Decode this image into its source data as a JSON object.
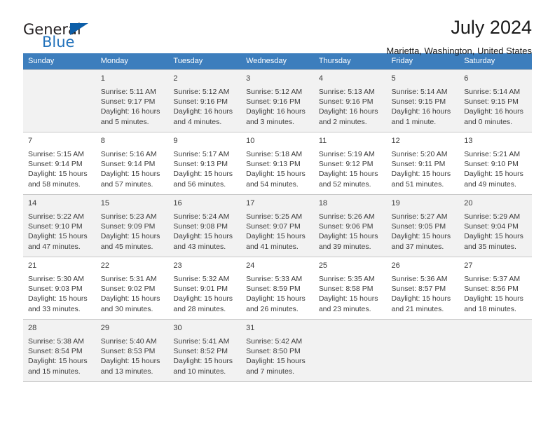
{
  "brand": {
    "name_part1": "General",
    "name_part2": "Blue",
    "triangle_color": "#0c5ea8",
    "blue_color": "#2272bb"
  },
  "header": {
    "title": "July 2024",
    "subtitle": "Marietta, Washington, United States",
    "header_bg_color": "#3d7ebd",
    "shaded_row_color": "#f2f2f2"
  },
  "weekday_headers": [
    "Sunday",
    "Monday",
    "Tuesday",
    "Wednesday",
    "Thursday",
    "Friday",
    "Saturday"
  ],
  "labels": {
    "sunrise": "Sunrise:",
    "sunset": "Sunset:",
    "daylight": "Daylight:"
  },
  "weeks": [
    {
      "shaded": true,
      "days": [
        {
          "num": "",
          "info": ""
        },
        {
          "num": "1",
          "info": "Sunrise: 5:11 AM\nSunset: 9:17 PM\nDaylight: 16 hours\nand 5 minutes."
        },
        {
          "num": "2",
          "info": "Sunrise: 5:12 AM\nSunset: 9:16 PM\nDaylight: 16 hours\nand 4 minutes."
        },
        {
          "num": "3",
          "info": "Sunrise: 5:12 AM\nSunset: 9:16 PM\nDaylight: 16 hours\nand 3 minutes."
        },
        {
          "num": "4",
          "info": "Sunrise: 5:13 AM\nSunset: 9:16 PM\nDaylight: 16 hours\nand 2 minutes."
        },
        {
          "num": "5",
          "info": "Sunrise: 5:14 AM\nSunset: 9:15 PM\nDaylight: 16 hours\nand 1 minute."
        },
        {
          "num": "6",
          "info": "Sunrise: 5:14 AM\nSunset: 9:15 PM\nDaylight: 16 hours\nand 0 minutes."
        }
      ]
    },
    {
      "shaded": false,
      "days": [
        {
          "num": "7",
          "info": "Sunrise: 5:15 AM\nSunset: 9:14 PM\nDaylight: 15 hours\nand 58 minutes."
        },
        {
          "num": "8",
          "info": "Sunrise: 5:16 AM\nSunset: 9:14 PM\nDaylight: 15 hours\nand 57 minutes."
        },
        {
          "num": "9",
          "info": "Sunrise: 5:17 AM\nSunset: 9:13 PM\nDaylight: 15 hours\nand 56 minutes."
        },
        {
          "num": "10",
          "info": "Sunrise: 5:18 AM\nSunset: 9:13 PM\nDaylight: 15 hours\nand 54 minutes."
        },
        {
          "num": "11",
          "info": "Sunrise: 5:19 AM\nSunset: 9:12 PM\nDaylight: 15 hours\nand 52 minutes."
        },
        {
          "num": "12",
          "info": "Sunrise: 5:20 AM\nSunset: 9:11 PM\nDaylight: 15 hours\nand 51 minutes."
        },
        {
          "num": "13",
          "info": "Sunrise: 5:21 AM\nSunset: 9:10 PM\nDaylight: 15 hours\nand 49 minutes."
        }
      ]
    },
    {
      "shaded": true,
      "days": [
        {
          "num": "14",
          "info": "Sunrise: 5:22 AM\nSunset: 9:10 PM\nDaylight: 15 hours\nand 47 minutes."
        },
        {
          "num": "15",
          "info": "Sunrise: 5:23 AM\nSunset: 9:09 PM\nDaylight: 15 hours\nand 45 minutes."
        },
        {
          "num": "16",
          "info": "Sunrise: 5:24 AM\nSunset: 9:08 PM\nDaylight: 15 hours\nand 43 minutes."
        },
        {
          "num": "17",
          "info": "Sunrise: 5:25 AM\nSunset: 9:07 PM\nDaylight: 15 hours\nand 41 minutes."
        },
        {
          "num": "18",
          "info": "Sunrise: 5:26 AM\nSunset: 9:06 PM\nDaylight: 15 hours\nand 39 minutes."
        },
        {
          "num": "19",
          "info": "Sunrise: 5:27 AM\nSunset: 9:05 PM\nDaylight: 15 hours\nand 37 minutes."
        },
        {
          "num": "20",
          "info": "Sunrise: 5:29 AM\nSunset: 9:04 PM\nDaylight: 15 hours\nand 35 minutes."
        }
      ]
    },
    {
      "shaded": false,
      "days": [
        {
          "num": "21",
          "info": "Sunrise: 5:30 AM\nSunset: 9:03 PM\nDaylight: 15 hours\nand 33 minutes."
        },
        {
          "num": "22",
          "info": "Sunrise: 5:31 AM\nSunset: 9:02 PM\nDaylight: 15 hours\nand 30 minutes."
        },
        {
          "num": "23",
          "info": "Sunrise: 5:32 AM\nSunset: 9:01 PM\nDaylight: 15 hours\nand 28 minutes."
        },
        {
          "num": "24",
          "info": "Sunrise: 5:33 AM\nSunset: 8:59 PM\nDaylight: 15 hours\nand 26 minutes."
        },
        {
          "num": "25",
          "info": "Sunrise: 5:35 AM\nSunset: 8:58 PM\nDaylight: 15 hours\nand 23 minutes."
        },
        {
          "num": "26",
          "info": "Sunrise: 5:36 AM\nSunset: 8:57 PM\nDaylight: 15 hours\nand 21 minutes."
        },
        {
          "num": "27",
          "info": "Sunrise: 5:37 AM\nSunset: 8:56 PM\nDaylight: 15 hours\nand 18 minutes."
        }
      ]
    },
    {
      "shaded": true,
      "days": [
        {
          "num": "28",
          "info": "Sunrise: 5:38 AM\nSunset: 8:54 PM\nDaylight: 15 hours\nand 15 minutes."
        },
        {
          "num": "29",
          "info": "Sunrise: 5:40 AM\nSunset: 8:53 PM\nDaylight: 15 hours\nand 13 minutes."
        },
        {
          "num": "30",
          "info": "Sunrise: 5:41 AM\nSunset: 8:52 PM\nDaylight: 15 hours\nand 10 minutes."
        },
        {
          "num": "31",
          "info": "Sunrise: 5:42 AM\nSunset: 8:50 PM\nDaylight: 15 hours\nand 7 minutes."
        },
        {
          "num": "",
          "info": ""
        },
        {
          "num": "",
          "info": ""
        },
        {
          "num": "",
          "info": ""
        }
      ]
    }
  ]
}
